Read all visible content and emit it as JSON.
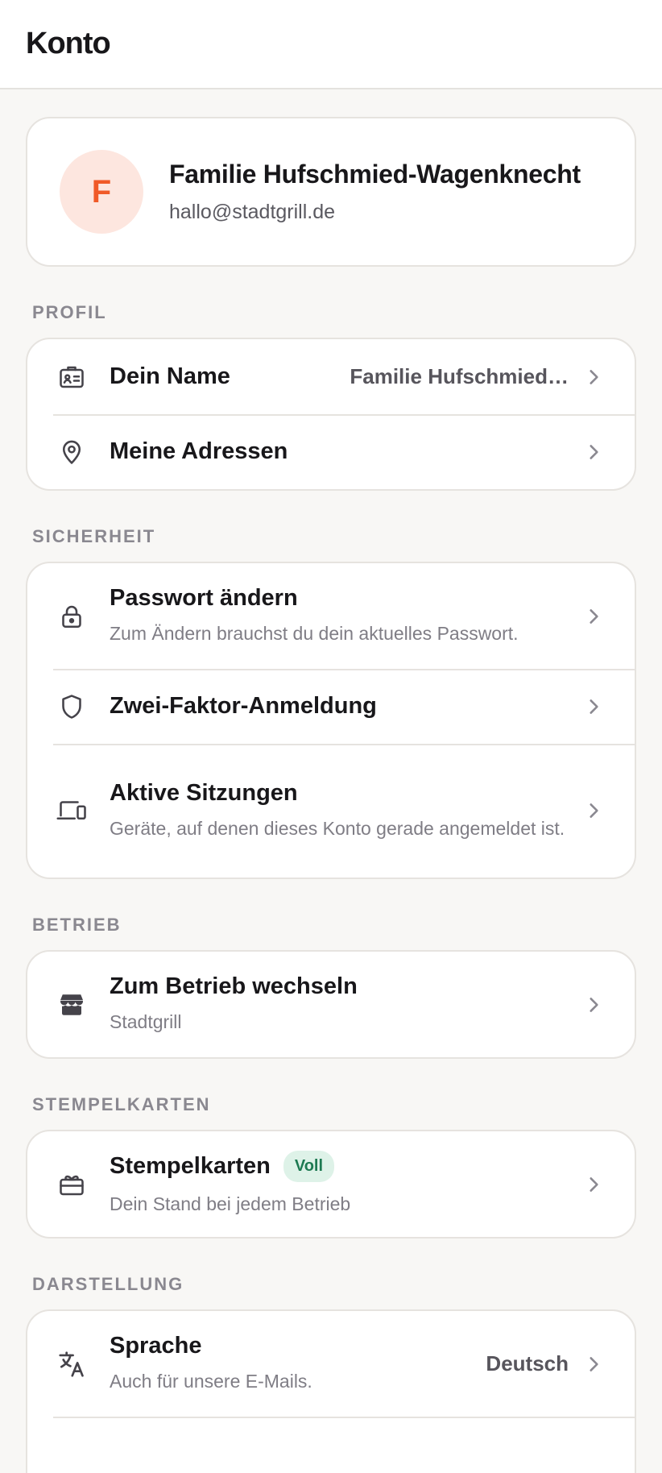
{
  "header": {
    "title": "Konto"
  },
  "profile": {
    "initial": "F",
    "name": "Familie Hufschmied-Wagenknecht",
    "email": "hallo@stadtgrill.de"
  },
  "sections": {
    "profil": {
      "label": "PROFIL",
      "rows": [
        {
          "title": "Dein Name",
          "value": "Familie Hufschmied…",
          "icon": "id-card-icon"
        },
        {
          "title": "Meine Adressen",
          "icon": "location-pin-icon"
        }
      ]
    },
    "sicherheit": {
      "label": "SICHERHEIT",
      "rows": [
        {
          "title": "Passwort ändern",
          "subtitle": "Zum Ändern brauchst du dein aktuelles Passwort.",
          "icon": "lock-icon"
        },
        {
          "title": "Zwei-Faktor-Anmeldung",
          "icon": "shield-icon"
        },
        {
          "title": "Aktive Sitzungen",
          "subtitle": "Geräte, auf denen dieses Konto gerade angemeldet ist.",
          "icon": "devices-icon"
        }
      ]
    },
    "betrieb": {
      "label": "BETRIEB",
      "rows": [
        {
          "title": "Zum Betrieb wechseln",
          "subtitle": "Stadtgrill",
          "icon": "store-icon"
        }
      ]
    },
    "stempelkarten": {
      "label": "STEMPELKARTEN",
      "rows": [
        {
          "title": "Stempelkarten",
          "badge": "Voll",
          "subtitle": "Dein Stand bei jedem Betrieb",
          "icon": "ticket-icon"
        }
      ]
    },
    "darstellung": {
      "label": "DARSTELLUNG",
      "rows": [
        {
          "title": "Sprache",
          "subtitle": "Auch für unsere E-Mails.",
          "value": "Deutsch",
          "icon": "translate-icon"
        }
      ]
    }
  }
}
